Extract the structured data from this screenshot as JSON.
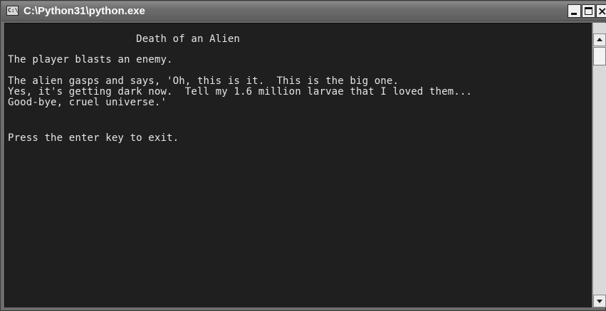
{
  "window": {
    "title": "C:\\Python31\\python.exe",
    "app_icon_text": "C:\\",
    "controls": {
      "minimize_label": "",
      "maximize_label": "",
      "close_label": "×"
    }
  },
  "console": {
    "lines": [
      "                     Death of an Alien",
      "The player blasts an enemy.",
      "The alien gasps and says, 'Oh, this is it.  This is the big one.",
      "Yes, it's getting dark now.  Tell my 1.6 million larvae that I loved them...",
      "Good-bye, cruel universe.'",
      "Press the enter key to exit."
    ],
    "colors": {
      "background": "#1f1f1f",
      "text": "#e6e6e6"
    }
  },
  "scrollbar": {
    "up_icon": "arrow-up-icon",
    "down_icon": "arrow-down-icon"
  }
}
